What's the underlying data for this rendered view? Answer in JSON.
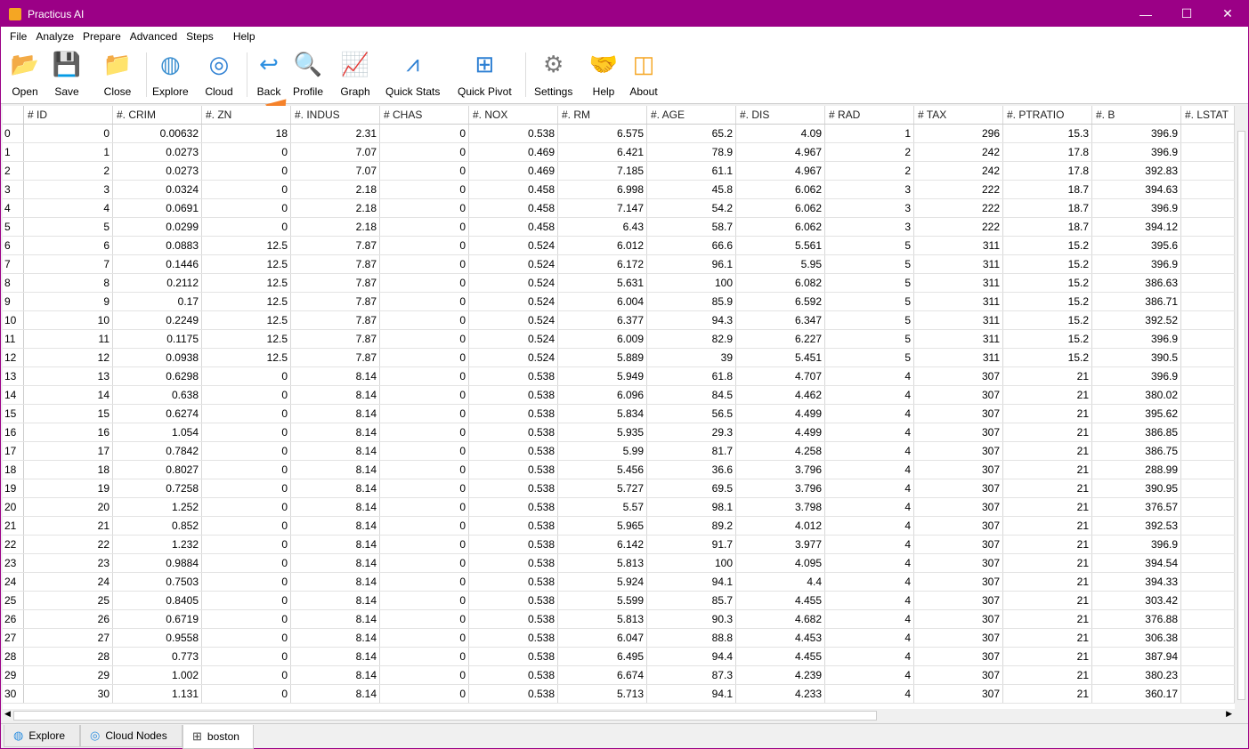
{
  "window": {
    "title": "Practicus AI",
    "controls": [
      "—",
      "☐",
      "✕"
    ]
  },
  "menu": [
    "File",
    "Analyze",
    "Prepare",
    "Advanced",
    "Steps",
    "Help"
  ],
  "toolbar": [
    {
      "label": "Open",
      "icon": "folder-open-icon",
      "glyph": "📂",
      "color": "#2f8fd8"
    },
    {
      "label": "Save",
      "icon": "save-icon",
      "glyph": "💾",
      "color": "#2f8fd8"
    },
    {
      "label": "Close",
      "icon": "close-folder-icon",
      "glyph": "📁",
      "color": "#2f8fd8"
    },
    {
      "label": "Explore",
      "icon": "explore-globe-icon",
      "glyph": "◍",
      "color": "#3b8fd0"
    },
    {
      "label": "Cloud",
      "icon": "cloud-icon",
      "glyph": "◎",
      "color": "#2d7fd3"
    },
    {
      "label": "Back",
      "icon": "back-arrow-icon",
      "glyph": "↩",
      "color": "#2d8fe0"
    },
    {
      "label": "Profile",
      "icon": "profile-magnifier-icon",
      "glyph": "🔍",
      "color": "#2d8fe0"
    },
    {
      "label": "Graph",
      "icon": "graph-icon",
      "glyph": "📈",
      "color": "#2d7fd3"
    },
    {
      "label": "Quick Stats",
      "icon": "bell-curve-icon",
      "glyph": "⩘",
      "color": "#2d7fd3"
    },
    {
      "label": "Quick Pivot",
      "icon": "pivot-icon",
      "glyph": "⊞",
      "color": "#2d7fd3"
    },
    {
      "label": "Settings",
      "icon": "gear-icon",
      "glyph": "⚙",
      "color": "#777777"
    },
    {
      "label": "Help",
      "icon": "handshake-icon",
      "glyph": "🤝",
      "color": "#c07050"
    },
    {
      "label": "About",
      "icon": "practicus-logo-icon",
      "glyph": "◫",
      "color": "#f5a623"
    }
  ],
  "table": {
    "headers": [
      "# ID",
      "#. CRIM",
      "#. ZN",
      "#. INDUS",
      "# CHAS",
      "#. NOX",
      "#. RM",
      "#. AGE",
      "#. DIS",
      "# RAD",
      "# TAX",
      "#. PTRATIO",
      "#. B",
      "#. LSTAT"
    ],
    "rows": [
      [
        "0",
        "0",
        "0.00632",
        "18",
        "2.31",
        "0",
        "0.538",
        "6.575",
        "65.2",
        "4.09",
        "1",
        "296",
        "15.3",
        "396.9"
      ],
      [
        "1",
        "1",
        "0.0273",
        "0",
        "7.07",
        "0",
        "0.469",
        "6.421",
        "78.9",
        "4.967",
        "2",
        "242",
        "17.8",
        "396.9"
      ],
      [
        "2",
        "2",
        "0.0273",
        "0",
        "7.07",
        "0",
        "0.469",
        "7.185",
        "61.1",
        "4.967",
        "2",
        "242",
        "17.8",
        "392.83"
      ],
      [
        "3",
        "3",
        "0.0324",
        "0",
        "2.18",
        "0",
        "0.458",
        "6.998",
        "45.8",
        "6.062",
        "3",
        "222",
        "18.7",
        "394.63"
      ],
      [
        "4",
        "4",
        "0.0691",
        "0",
        "2.18",
        "0",
        "0.458",
        "7.147",
        "54.2",
        "6.062",
        "3",
        "222",
        "18.7",
        "396.9"
      ],
      [
        "5",
        "5",
        "0.0299",
        "0",
        "2.18",
        "0",
        "0.458",
        "6.43",
        "58.7",
        "6.062",
        "3",
        "222",
        "18.7",
        "394.12"
      ],
      [
        "6",
        "6",
        "0.0883",
        "12.5",
        "7.87",
        "0",
        "0.524",
        "6.012",
        "66.6",
        "5.561",
        "5",
        "311",
        "15.2",
        "395.6"
      ],
      [
        "7",
        "7",
        "0.1446",
        "12.5",
        "7.87",
        "0",
        "0.524",
        "6.172",
        "96.1",
        "5.95",
        "5",
        "311",
        "15.2",
        "396.9"
      ],
      [
        "8",
        "8",
        "0.2112",
        "12.5",
        "7.87",
        "0",
        "0.524",
        "5.631",
        "100",
        "6.082",
        "5",
        "311",
        "15.2",
        "386.63"
      ],
      [
        "9",
        "9",
        "0.17",
        "12.5",
        "7.87",
        "0",
        "0.524",
        "6.004",
        "85.9",
        "6.592",
        "5",
        "311",
        "15.2",
        "386.71"
      ],
      [
        "10",
        "10",
        "0.2249",
        "12.5",
        "7.87",
        "0",
        "0.524",
        "6.377",
        "94.3",
        "6.347",
        "5",
        "311",
        "15.2",
        "392.52"
      ],
      [
        "11",
        "11",
        "0.1175",
        "12.5",
        "7.87",
        "0",
        "0.524",
        "6.009",
        "82.9",
        "6.227",
        "5",
        "311",
        "15.2",
        "396.9"
      ],
      [
        "12",
        "12",
        "0.0938",
        "12.5",
        "7.87",
        "0",
        "0.524",
        "5.889",
        "39",
        "5.451",
        "5",
        "311",
        "15.2",
        "390.5"
      ],
      [
        "13",
        "13",
        "0.6298",
        "0",
        "8.14",
        "0",
        "0.538",
        "5.949",
        "61.8",
        "4.707",
        "4",
        "307",
        "21",
        "396.9"
      ],
      [
        "14",
        "14",
        "0.638",
        "0",
        "8.14",
        "0",
        "0.538",
        "6.096",
        "84.5",
        "4.462",
        "4",
        "307",
        "21",
        "380.02"
      ],
      [
        "15",
        "15",
        "0.6274",
        "0",
        "8.14",
        "0",
        "0.538",
        "5.834",
        "56.5",
        "4.499",
        "4",
        "307",
        "21",
        "395.62"
      ],
      [
        "16",
        "16",
        "1.054",
        "0",
        "8.14",
        "0",
        "0.538",
        "5.935",
        "29.3",
        "4.499",
        "4",
        "307",
        "21",
        "386.85"
      ],
      [
        "17",
        "17",
        "0.7842",
        "0",
        "8.14",
        "0",
        "0.538",
        "5.99",
        "81.7",
        "4.258",
        "4",
        "307",
        "21",
        "386.75"
      ],
      [
        "18",
        "18",
        "0.8027",
        "0",
        "8.14",
        "0",
        "0.538",
        "5.456",
        "36.6",
        "3.796",
        "4",
        "307",
        "21",
        "288.99"
      ],
      [
        "19",
        "19",
        "0.7258",
        "0",
        "8.14",
        "0",
        "0.538",
        "5.727",
        "69.5",
        "3.796",
        "4",
        "307",
        "21",
        "390.95"
      ],
      [
        "20",
        "20",
        "1.252",
        "0",
        "8.14",
        "0",
        "0.538",
        "5.57",
        "98.1",
        "3.798",
        "4",
        "307",
        "21",
        "376.57"
      ],
      [
        "21",
        "21",
        "0.852",
        "0",
        "8.14",
        "0",
        "0.538",
        "5.965",
        "89.2",
        "4.012",
        "4",
        "307",
        "21",
        "392.53"
      ],
      [
        "22",
        "22",
        "1.232",
        "0",
        "8.14",
        "0",
        "0.538",
        "6.142",
        "91.7",
        "3.977",
        "4",
        "307",
        "21",
        "396.9"
      ],
      [
        "23",
        "23",
        "0.9884",
        "0",
        "8.14",
        "0",
        "0.538",
        "5.813",
        "100",
        "4.095",
        "4",
        "307",
        "21",
        "394.54"
      ],
      [
        "24",
        "24",
        "0.7503",
        "0",
        "8.14",
        "0",
        "0.538",
        "5.924",
        "94.1",
        "4.4",
        "4",
        "307",
        "21",
        "394.33"
      ],
      [
        "25",
        "25",
        "0.8405",
        "0",
        "8.14",
        "0",
        "0.538",
        "5.599",
        "85.7",
        "4.455",
        "4",
        "307",
        "21",
        "303.42"
      ],
      [
        "26",
        "26",
        "0.6719",
        "0",
        "8.14",
        "0",
        "0.538",
        "5.813",
        "90.3",
        "4.682",
        "4",
        "307",
        "21",
        "376.88"
      ],
      [
        "27",
        "27",
        "0.9558",
        "0",
        "8.14",
        "0",
        "0.538",
        "6.047",
        "88.8",
        "4.453",
        "4",
        "307",
        "21",
        "306.38"
      ],
      [
        "28",
        "28",
        "0.773",
        "0",
        "8.14",
        "0",
        "0.538",
        "6.495",
        "94.4",
        "4.455",
        "4",
        "307",
        "21",
        "387.94"
      ],
      [
        "29",
        "29",
        "1.002",
        "0",
        "8.14",
        "0",
        "0.538",
        "6.674",
        "87.3",
        "4.239",
        "4",
        "307",
        "21",
        "380.23"
      ],
      [
        "30",
        "30",
        "1.131",
        "0",
        "8.14",
        "0",
        "0.538",
        "5.713",
        "94.1",
        "4.233",
        "4",
        "307",
        "21",
        "360.17"
      ]
    ]
  },
  "tabs": [
    {
      "label": "Explore",
      "icon": "explore-globe-icon",
      "glyph": "◍",
      "active": false
    },
    {
      "label": "Cloud Nodes",
      "icon": "cloud-icon",
      "glyph": "◎",
      "active": false
    },
    {
      "label": "boston",
      "icon": "table-grid-icon",
      "glyph": "⊞",
      "active": true
    }
  ]
}
